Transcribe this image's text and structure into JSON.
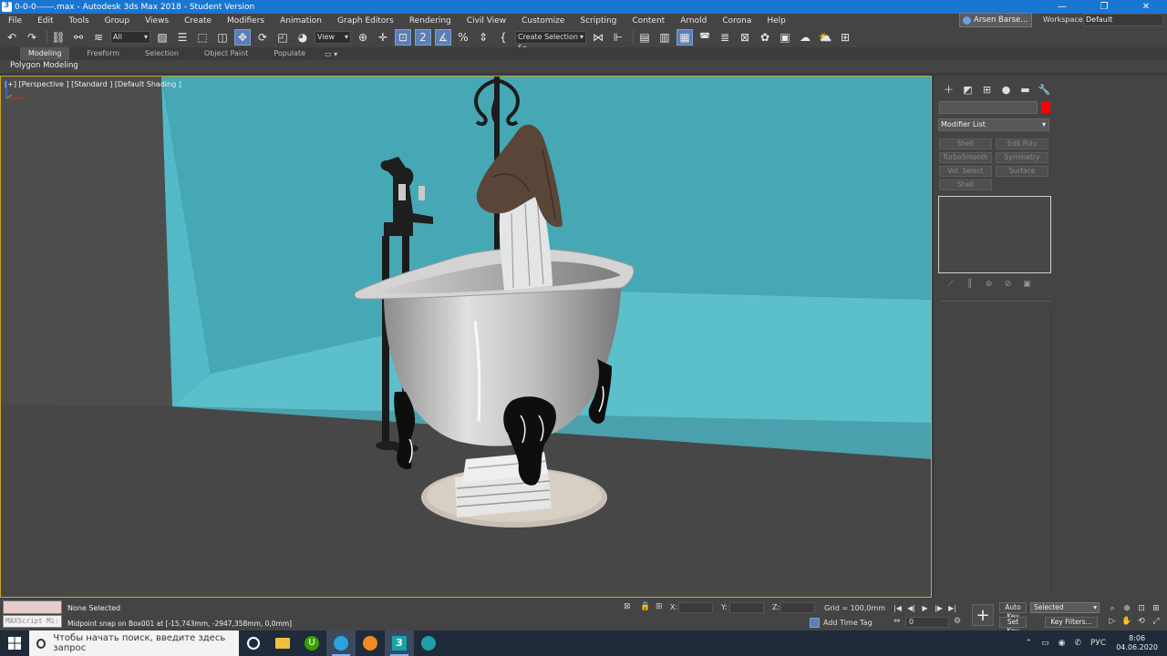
{
  "titlebar": {
    "title": "0-0-0------.max - Autodesk 3ds Max 2018 - Student Version",
    "minimize": "—",
    "restore": "❐",
    "close": "✕"
  },
  "menu": [
    "File",
    "Edit",
    "Tools",
    "Group",
    "Views",
    "Create",
    "Modifiers",
    "Animation",
    "Graph Editors",
    "Rendering",
    "Civil View",
    "Customize",
    "Scripting",
    "Content",
    "Arnold",
    "Corona",
    "Help"
  ],
  "user": {
    "name": "Arsen Barse...",
    "workspaces_label": "Workspaces:",
    "workspace": "Default"
  },
  "toolbar": {
    "filter_select": "All",
    "refcoord_select": "View",
    "named_selection": "Create Selection Se"
  },
  "ribbon": {
    "tabs": [
      "Modeling",
      "Freeform",
      "Selection",
      "Object Paint",
      "Populate"
    ],
    "active_tab": "Modeling",
    "options_glyph": "▭ ▾",
    "subpanel": "Polygon Modeling"
  },
  "viewport": {
    "label": "[+] [Perspective ] [Standard ] [Default Shading ]",
    "colors": {
      "wall": "#4aa9b6",
      "floor": "#474747",
      "border": "#c9a227"
    }
  },
  "command_panel": {
    "tab_icons": [
      "create-icon",
      "modify-icon",
      "hierarchy-icon",
      "motion-icon",
      "display-icon",
      "utilities-icon"
    ],
    "tab_glyphs": [
      "＋",
      "◩",
      "⊞",
      "●",
      "▬",
      "🔧"
    ],
    "object_color": "#ff0000",
    "modifier_list": "Modifier List",
    "modifier_buttons": [
      "Shell",
      "Edit Poly",
      "TurboSmooth",
      "Symmetry",
      "Vol. Select",
      "Surface",
      "Shell"
    ],
    "stack_tool_glyphs": [
      "⟋",
      "║",
      "⊚",
      "⊘",
      "▣"
    ]
  },
  "status": {
    "maxscript_placeholder": "MAXScript Mi:",
    "selection": "None Selected",
    "prompt": "Midpoint snap on Box001 at [-15,743mm, -2947,358mm, 0,0mm]",
    "x_label": "X:",
    "y_label": "Y:",
    "z_label": "Z:",
    "grid": "Grid = 100,0mm",
    "add_time_tag": "Add Time Tag",
    "frame": "0",
    "auto_key": "Auto Key",
    "set_key": "Set Key",
    "selected": "Selected",
    "key_filters": "Key Filters..."
  },
  "taskbar": {
    "search_placeholder": "Чтобы начать поиск, введите здесь запрос",
    "lang": "РУС",
    "time": "8:06",
    "date": "04.06.2020",
    "tray_glyphs": [
      "⌃",
      "▭",
      "◉",
      "✆"
    ]
  }
}
